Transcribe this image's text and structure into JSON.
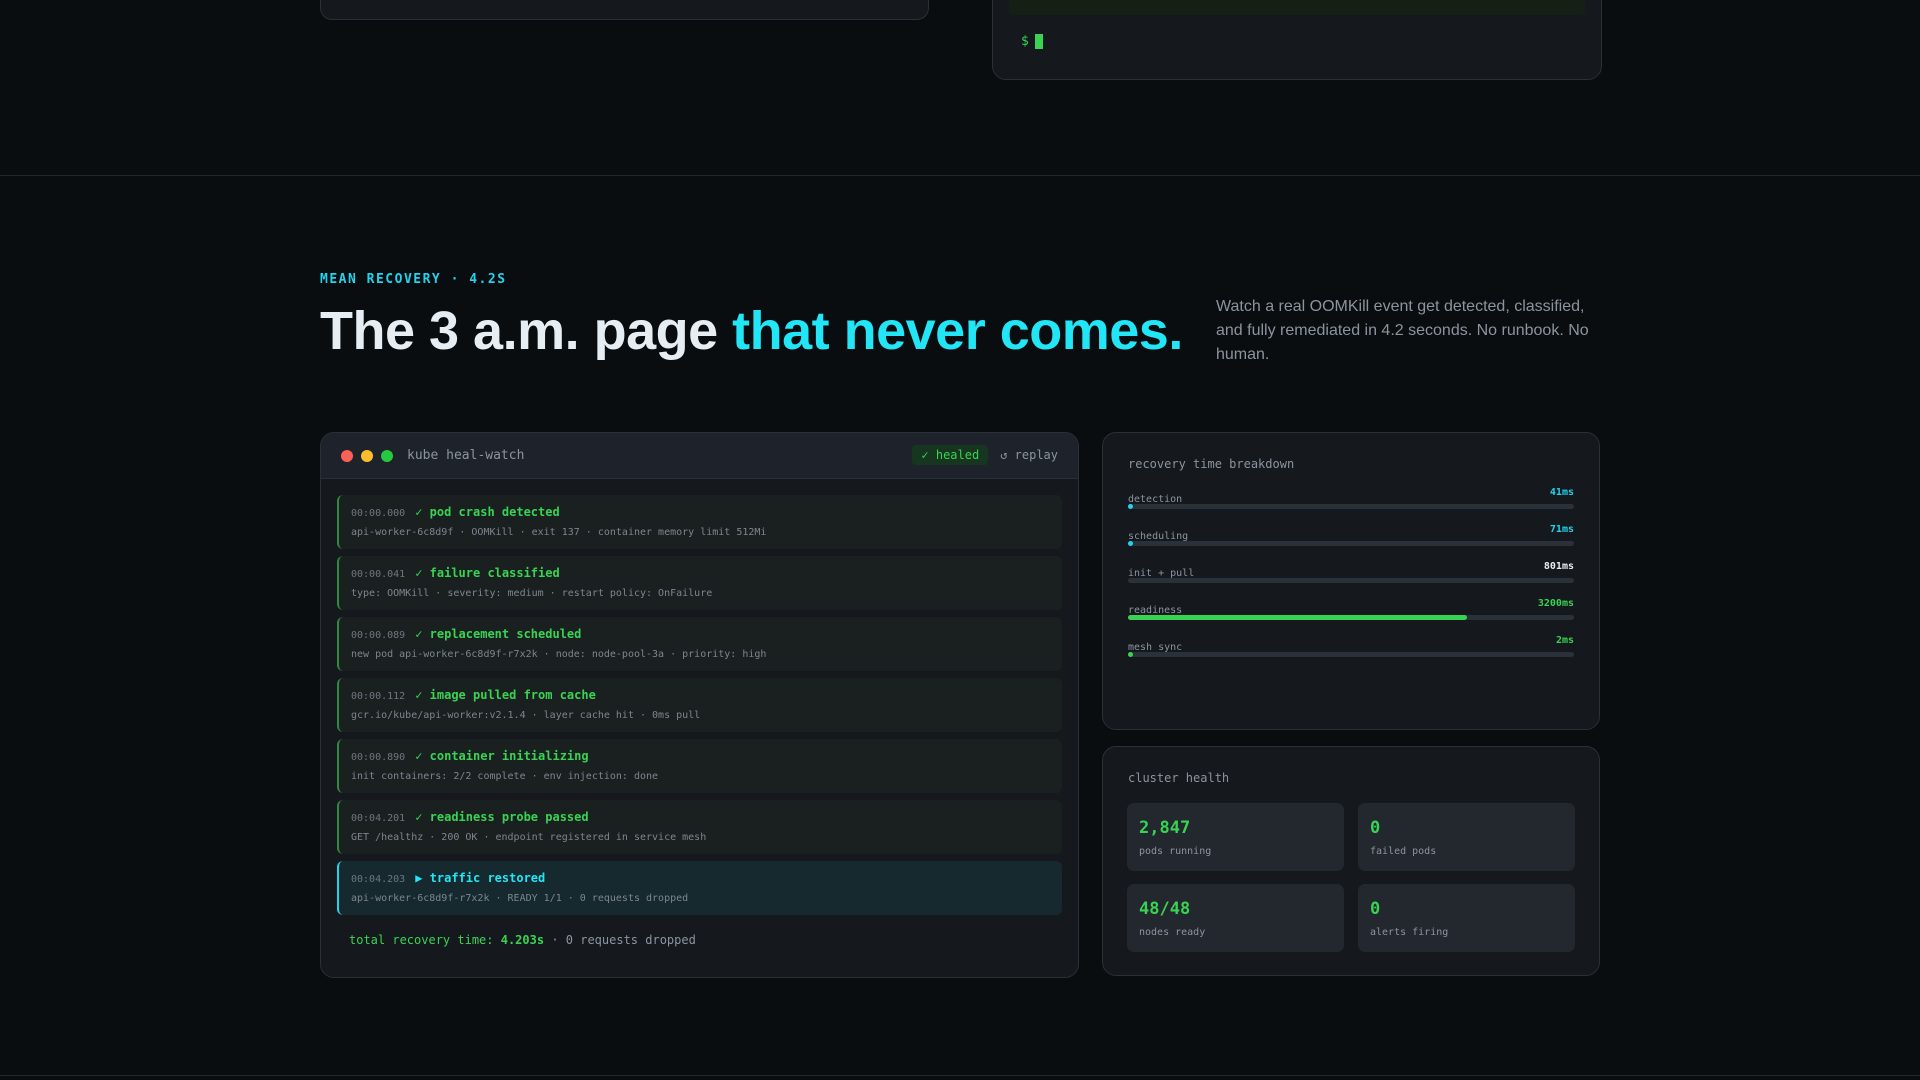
{
  "top": {
    "prompt_symbol": "$"
  },
  "hero": {
    "eyebrow": "MEAN RECOVERY · 4.2S",
    "headline_plain": "The 3 a.m. page ",
    "headline_accent": "that never comes.",
    "lede": "Watch a real OOMKill event get detected, classified, and fully remediated in 4.2 seconds. No runbook. No human."
  },
  "terminal": {
    "title": "kube heal-watch",
    "status_badge": "✓ healed",
    "replay_label": "↺ replay",
    "events": [
      {
        "time": "00:00.000",
        "icon": "✓",
        "title": "pod crash detected",
        "detail": "api-worker-6c8d9f · OOMKill · exit 137 · container memory limit 512Mi"
      },
      {
        "time": "00:00.041",
        "icon": "✓",
        "title": "failure classified",
        "detail": "type: OOMKill · severity: medium · restart policy: OnFailure"
      },
      {
        "time": "00:00.089",
        "icon": "✓",
        "title": "replacement scheduled",
        "detail": "new pod api-worker-6c8d9f-r7x2k · node: node-pool-3a · priority: high"
      },
      {
        "time": "00:00.112",
        "icon": "✓",
        "title": "image pulled from cache",
        "detail": "gcr.io/kube/api-worker:v2.1.4 · layer cache hit · 0ms pull"
      },
      {
        "time": "00:00.890",
        "icon": "✓",
        "title": "container initializing",
        "detail": "init containers: 2/2 complete · env injection: done"
      },
      {
        "time": "00:04.201",
        "icon": "✓",
        "title": "readiness probe passed",
        "detail": "GET /healthz · 200 OK · endpoint registered in service mesh"
      },
      {
        "time": "00:04.203",
        "icon": "▶",
        "title": "traffic restored",
        "detail": "api-worker-6c8d9f-r7x2k · READY 1/1 · 0 requests dropped"
      }
    ],
    "total_label": "total recovery time:",
    "total_value": "4.203s",
    "total_suffix": " · 0 requests dropped"
  },
  "breakdown": {
    "title": "recovery time breakdown",
    "rows": [
      {
        "label": "detection",
        "value": "41ms",
        "fraction": 0.01,
        "color": "#22d3ee"
      },
      {
        "label": "scheduling",
        "value": "71ms",
        "fraction": 0.017,
        "color": "#22d3ee"
      },
      {
        "label": "init + pull",
        "value": "801ms",
        "fraction": 0.0,
        "color": "#e6edf3"
      },
      {
        "label": "readiness",
        "value": "3200ms",
        "fraction": 0.76,
        "color": "#39d353"
      },
      {
        "label": "mesh sync",
        "value": "2ms",
        "fraction": 0.003,
        "color": "#39d353"
      }
    ]
  },
  "health": {
    "title": "cluster health",
    "stats": [
      {
        "value": "2,847",
        "label": "pods running"
      },
      {
        "value": "0",
        "label": "failed pods"
      },
      {
        "value": "48/48",
        "label": "nodes ready"
      },
      {
        "value": "0",
        "label": "alerts firing"
      }
    ]
  },
  "colors": {
    "accent_cyan": "#22e5f5",
    "accent_green": "#39d353",
    "bg": "#0a0d0f"
  }
}
